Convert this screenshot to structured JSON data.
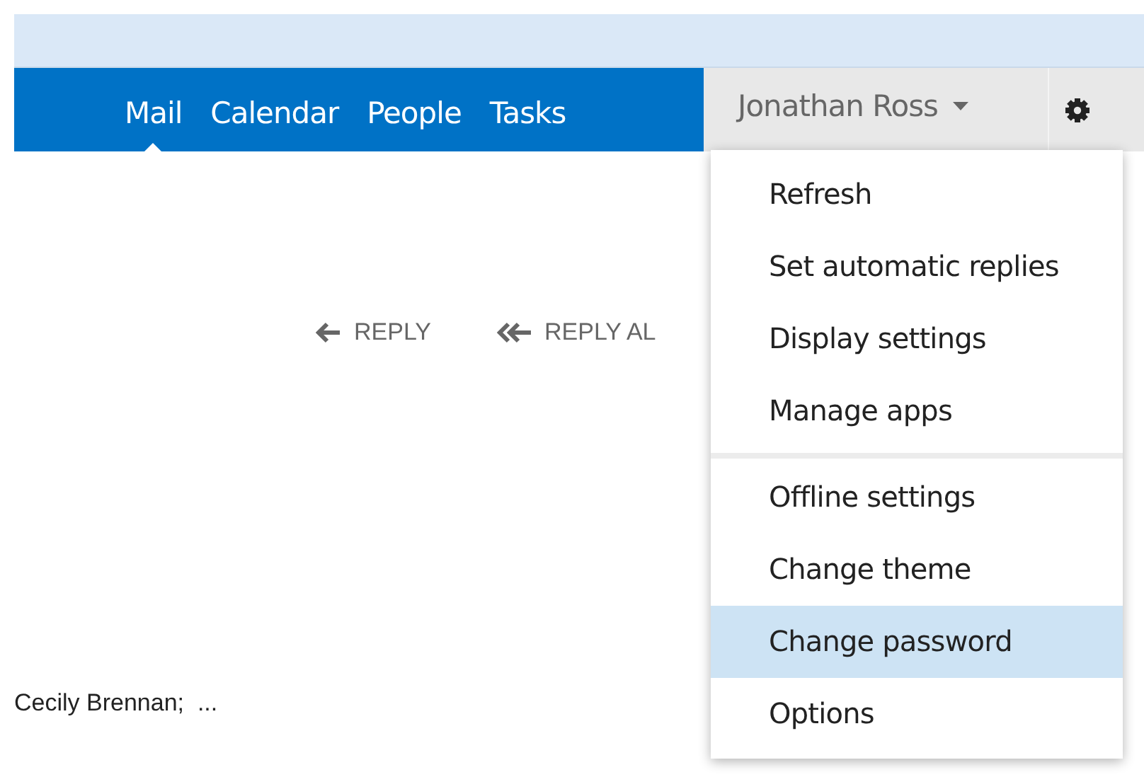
{
  "nav": {
    "tabs": [
      {
        "label": "Mail",
        "selected": true
      },
      {
        "label": "Calendar",
        "selected": false
      },
      {
        "label": "People",
        "selected": false
      },
      {
        "label": "Tasks",
        "selected": false
      }
    ],
    "user": {
      "name": "Jonathan Ross"
    }
  },
  "actions": [
    {
      "label": "REPLY",
      "kind": "single"
    },
    {
      "label": "REPLY AL",
      "kind": "double"
    }
  ],
  "recipients": "Cecily Brennan;  ...",
  "menu": {
    "groups": [
      [
        {
          "label": "Refresh",
          "selected": false
        },
        {
          "label": "Set automatic replies",
          "selected": false
        },
        {
          "label": "Display settings",
          "selected": false
        },
        {
          "label": "Manage apps",
          "selected": false
        }
      ],
      [
        {
          "label": "Offline settings",
          "selected": false
        },
        {
          "label": "Change theme",
          "selected": false
        },
        {
          "label": "Change password",
          "selected": true
        },
        {
          "label": "Options",
          "selected": false
        }
      ]
    ]
  }
}
